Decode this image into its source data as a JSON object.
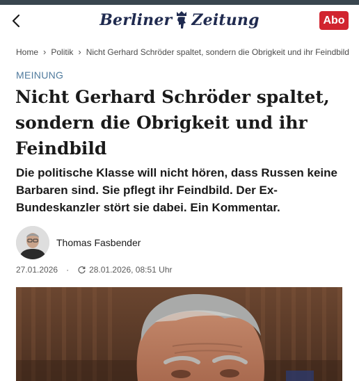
{
  "header": {
    "logo_text": "Berliner Zeitung",
    "abo_label": "Abo"
  },
  "breadcrumb": [
    "Home",
    "Politik",
    "Nicht Gerhard Schröder spaltet, sondern die Obrigkeit und ihr Feindbild"
  ],
  "article": {
    "kicker": "MEINUNG",
    "headline": "Nicht Gerhard Schröder spaltet, sondern die Obrigkeit und ihr Feindbild",
    "teaser": "Die politische Klasse will nicht hören, dass Russen keine Barbaren sind. Sie pflegt ihr Feindbild. Der Ex-Bundeskanzler stört sie dabei. Ein Kommentar.",
    "author": "Thomas Fasbender",
    "published": "27.01.2026",
    "updated": "28.01.2026, 08:51 Uhr"
  },
  "colors": {
    "topbar": "#39464f",
    "brand_navy": "#1f2a4f",
    "abo_red": "#d1242f",
    "kicker_blue": "#4f7a9d"
  },
  "icons": [
    "back-arrow-icon",
    "bear-crest-icon",
    "chevron-right-icon",
    "refresh-icon"
  ]
}
